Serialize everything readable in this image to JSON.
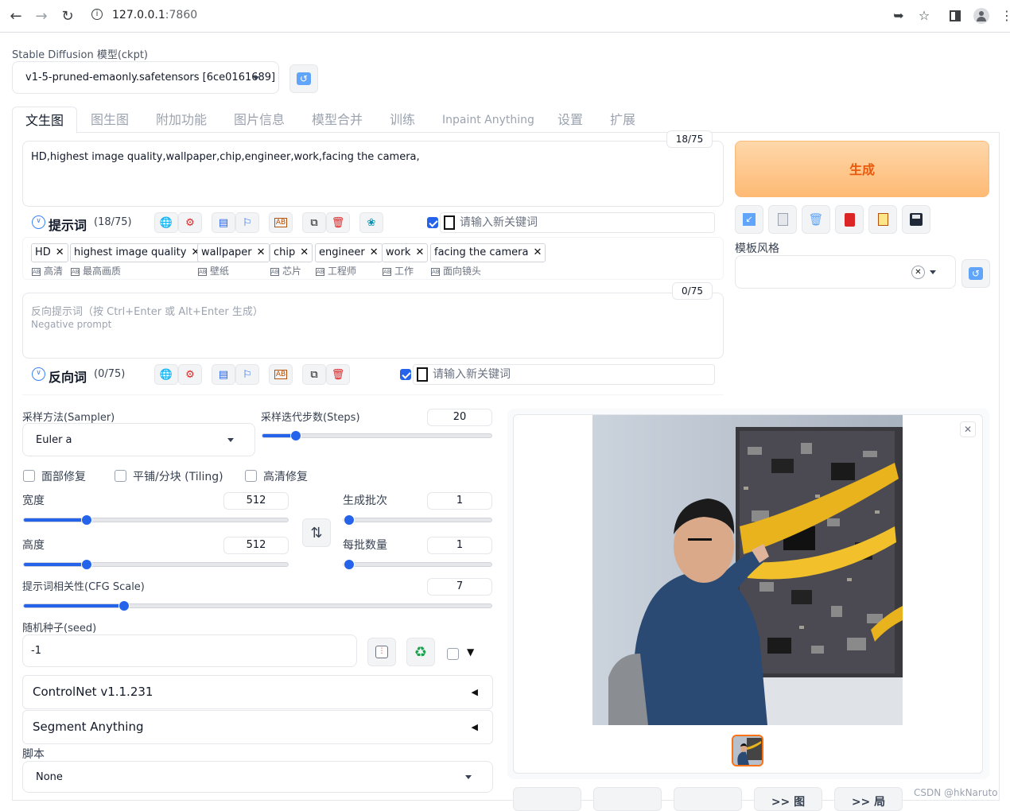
{
  "browser": {
    "url_host": "127.0.0.1",
    "url_port": ":7860",
    "back_icon": "arrow-left-icon",
    "forward_icon": "arrow-right-icon",
    "reload_icon": "reload-icon",
    "info_icon": "info-icon",
    "share_icon": "share-icon",
    "star_icon": "star-icon",
    "sidepanel_icon": "sidepanel-icon",
    "profile_icon": "profile-icon",
    "menu_icon": "menu-icon"
  },
  "model": {
    "label": "Stable Diffusion 模型(ckpt)",
    "selected": "v1-5-pruned-emaonly.safetensors [6ce0161689]",
    "refresh_icon": "refresh-icon"
  },
  "tabs": [
    {
      "label": "文生图",
      "active": true
    },
    {
      "label": "图生图"
    },
    {
      "label": "附加功能"
    },
    {
      "label": "图片信息"
    },
    {
      "label": "模型合并"
    },
    {
      "label": "训练"
    },
    {
      "label": "Inpaint Anything"
    },
    {
      "label": "设置"
    },
    {
      "label": "扩展"
    }
  ],
  "prompt": {
    "text": "HD,highest image quality,wallpaper,chip,engineer,work,facing the camera,",
    "counter": "18/75",
    "title": "提示词",
    "title_count": "(18/75)",
    "keyword_placeholder": "请输入新关键词",
    "tags": [
      {
        "en": "HD",
        "zh": "高清"
      },
      {
        "en": "highest image quality",
        "zh": "最高画质"
      },
      {
        "en": "wallpaper",
        "zh": "壁纸"
      },
      {
        "en": "chip",
        "zh": "芯片"
      },
      {
        "en": "engineer",
        "zh": "工程师"
      },
      {
        "en": "work",
        "zh": "工作"
      },
      {
        "en": "facing the camera",
        "zh": "面向镜头"
      }
    ]
  },
  "negative": {
    "placeholder_line1": "反向提示词（按 Ctrl+Enter 或 Alt+Enter 生成）",
    "placeholder_line2": "Negative prompt",
    "counter": "0/75",
    "title": "反向词",
    "title_count": "(0/75)",
    "keyword_placeholder": "请输入新关键词"
  },
  "generate": {
    "label": "生成",
    "style_label": "模板风格",
    "tools": [
      "arrow-icon",
      "page-icon",
      "trash-icon",
      "card-icon",
      "clipboard-icon",
      "save-icon"
    ]
  },
  "sampler": {
    "label": "采样方法(Sampler)",
    "value": "Euler a",
    "steps_label": "采样迭代步数(Steps)",
    "steps": 20,
    "steps_min": 1,
    "steps_max": 150
  },
  "options": {
    "face_restore": "面部修复",
    "tiling": "平铺/分块 (Tiling)",
    "hires": "高清修复"
  },
  "size": {
    "width_label": "宽度",
    "width": 512,
    "height_label": "高度",
    "height": 512,
    "min": 64,
    "max": 2048,
    "batch_count_label": "生成批次",
    "batch_count": 1,
    "batch_size_label": "每批数量",
    "batch_size": 1,
    "swap_icon": "swap-icon"
  },
  "cfg": {
    "label": "提示词相关性(CFG Scale)",
    "value": 7,
    "min": 1,
    "max": 30
  },
  "seed": {
    "label": "随机种子(seed)",
    "value": "-1",
    "dice_icon": "dice-icon",
    "recycle_icon": "recycle-icon"
  },
  "accordions": {
    "controlnet": "ControlNet v1.1.231",
    "segment": "Segment Anything"
  },
  "script": {
    "label": "脚本",
    "value": "None"
  },
  "output_buttons": [
    "",
    "",
    "",
    ">> 图",
    ">> 局"
  ],
  "watermark": "CSDN @hkNaruto"
}
